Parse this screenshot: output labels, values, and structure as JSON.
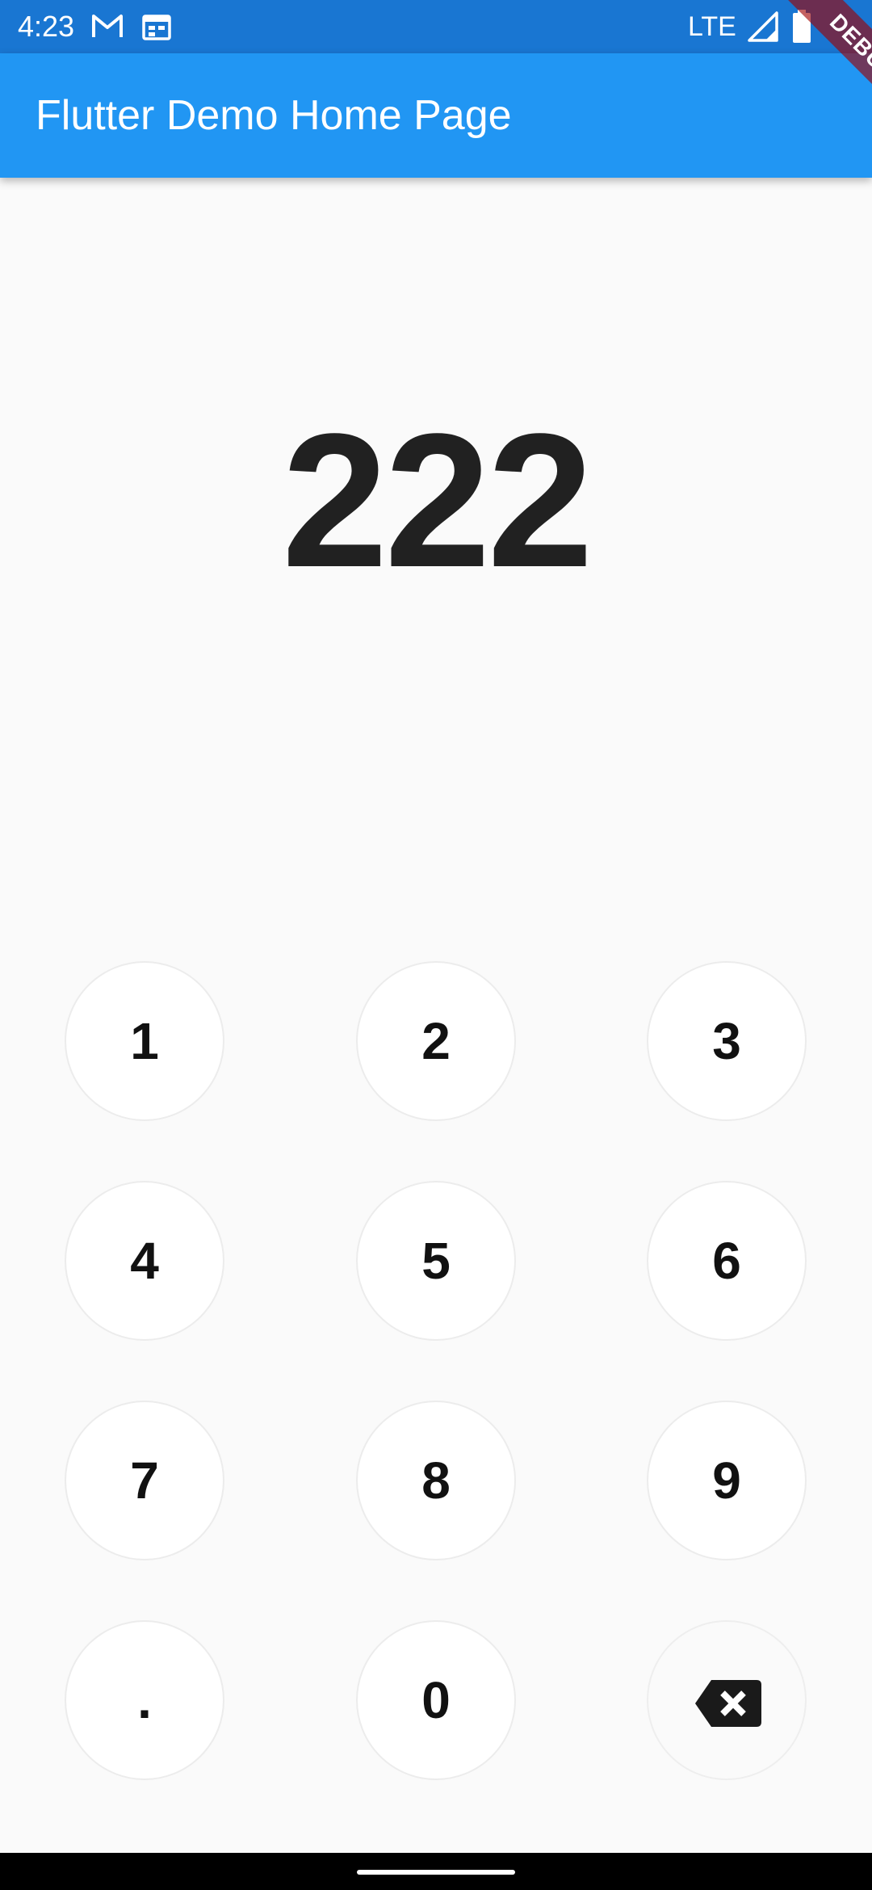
{
  "status_bar": {
    "time": "4:23",
    "network": "LTE",
    "icons": [
      "gmail-icon",
      "calendar-icon",
      "signal-icon",
      "battery-icon"
    ],
    "background_color": "#1976d2"
  },
  "app_bar": {
    "title": "Flutter Demo Home Page",
    "background_color": "#2196f3"
  },
  "debug_banner": {
    "label": "DEBUG"
  },
  "display": {
    "value": "222"
  },
  "keypad": {
    "keys": [
      "1",
      "2",
      "3",
      "4",
      "5",
      "6",
      "7",
      "8",
      "9",
      ".",
      "0"
    ],
    "backspace_icon": "backspace-icon"
  }
}
